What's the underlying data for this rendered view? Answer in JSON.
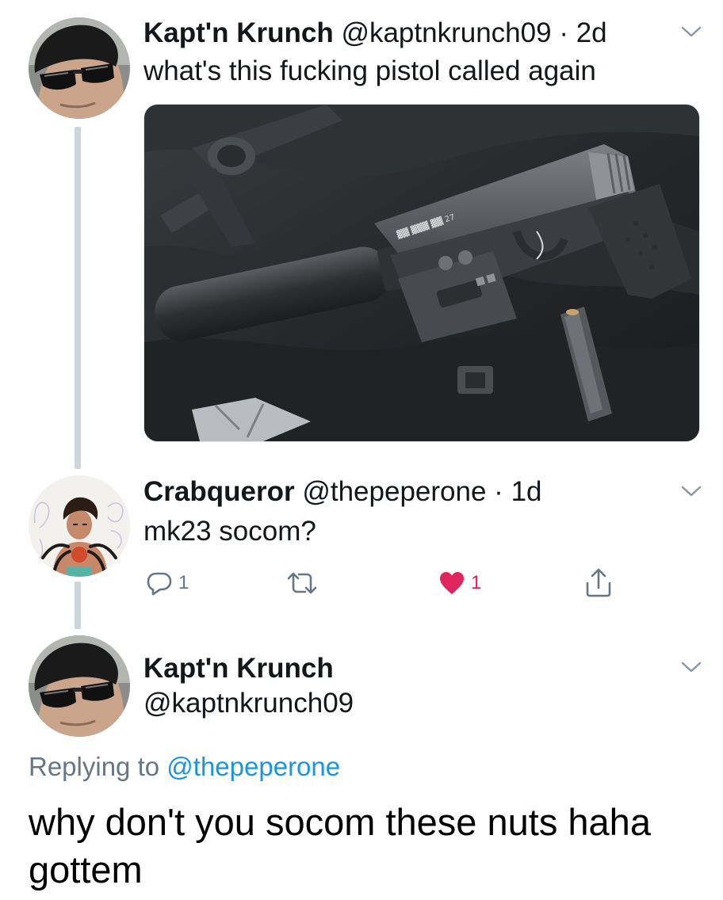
{
  "tweet1": {
    "name": "Kapt'n Krunch",
    "handle": "@kaptnkrunch09",
    "separator": "·",
    "time": "2d",
    "text": "what's this fucking pistol called again"
  },
  "tweet2": {
    "name": "Crabqueror",
    "handle": "@thepeperone",
    "separator": "·",
    "time": "1d",
    "text": "mk23 socom?",
    "actions": {
      "reply_count": "1",
      "retweet_count": "",
      "like_count": "1",
      "liked": true
    }
  },
  "tweet3": {
    "name": "Kapt'n Krunch",
    "handle": "@kaptnkrunch09",
    "replying_prefix": "Replying to",
    "replying_to": "@thepeperone",
    "text": "why don't you socom these nuts haha gottem"
  },
  "colors": {
    "text": "#14171a",
    "secondary": "#657786",
    "link": "#1b95e0",
    "like": "#e0245e",
    "thread_line": "#ccd6dd"
  }
}
